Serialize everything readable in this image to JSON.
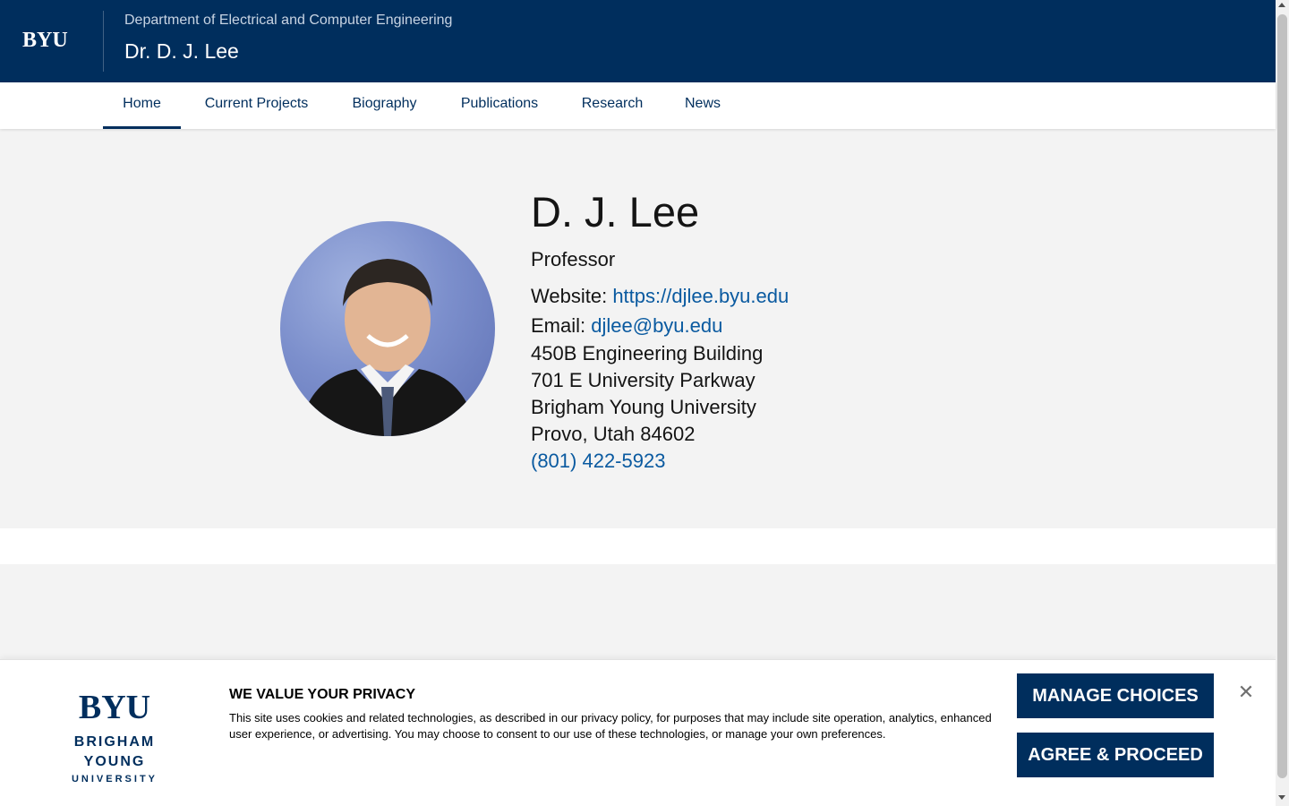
{
  "header": {
    "logo": "BYU",
    "department": "Department of Electrical and Computer Engineering",
    "site_title": "Dr. D. J. Lee"
  },
  "nav": {
    "items": [
      {
        "label": "Home",
        "active": true
      },
      {
        "label": "Current Projects",
        "active": false
      },
      {
        "label": "Biography",
        "active": false
      },
      {
        "label": "Publications",
        "active": false
      },
      {
        "label": "Research",
        "active": false
      },
      {
        "label": "News",
        "active": false
      }
    ]
  },
  "profile": {
    "name": "D. J. Lee",
    "title": "Professor",
    "website_label": "Website:",
    "website_url": "https://djlee.byu.edu",
    "email_label": "Email:",
    "email": "djlee@byu.edu",
    "address": [
      "450B Engineering Building",
      "701 E University Parkway",
      "Brigham Young University",
      "Provo, Utah 84602"
    ],
    "phone": "(801) 422-5923"
  },
  "consent": {
    "logo_big": "BYU",
    "logo_mid": "BRIGHAM YOUNG",
    "logo_small": "UNIVERSITY",
    "title": "WE VALUE YOUR PRIVACY",
    "text": "This site uses cookies and related technologies, as described in our privacy policy, for purposes that may include site operation, analytics, enhanced user experience, or advertising. You may choose to consent to our use of these technologies, or manage your own preferences.",
    "manage_label": "MANAGE CHOICES",
    "agree_label": "AGREE & PROCEED",
    "close_glyph": "✕"
  },
  "colors": {
    "brand_navy": "#002e5d",
    "link_blue": "#0a5aa0",
    "band_gray": "#f3f3f3"
  },
  "icons": {
    "close": "close-icon",
    "scroll_up": "arrow-up-icon",
    "scroll_down": "arrow-down-icon"
  }
}
